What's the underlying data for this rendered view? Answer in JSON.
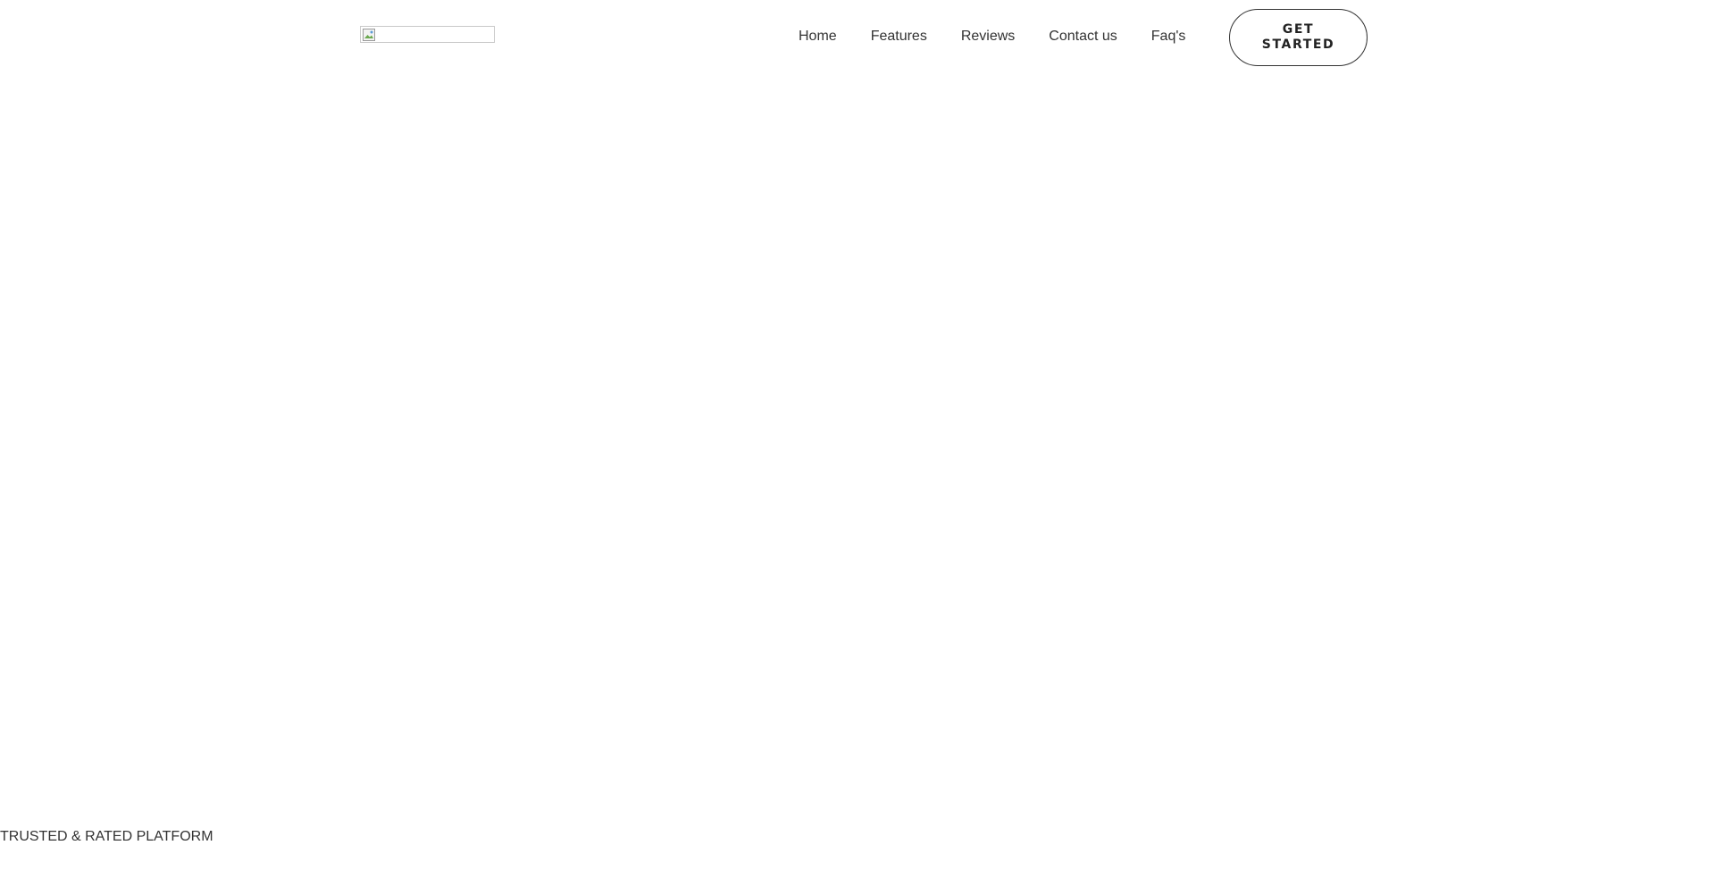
{
  "header": {
    "logo_icon": "broken-image-icon",
    "nav": [
      {
        "label": "Home"
      },
      {
        "label": "Features"
      },
      {
        "label": "Reviews"
      },
      {
        "label": "Contact us"
      },
      {
        "label": "Faq's"
      }
    ],
    "cta_label": "GET STARTED"
  },
  "hero": {
    "eyebrow": "TRUSTED & RATED PLATFORM"
  }
}
